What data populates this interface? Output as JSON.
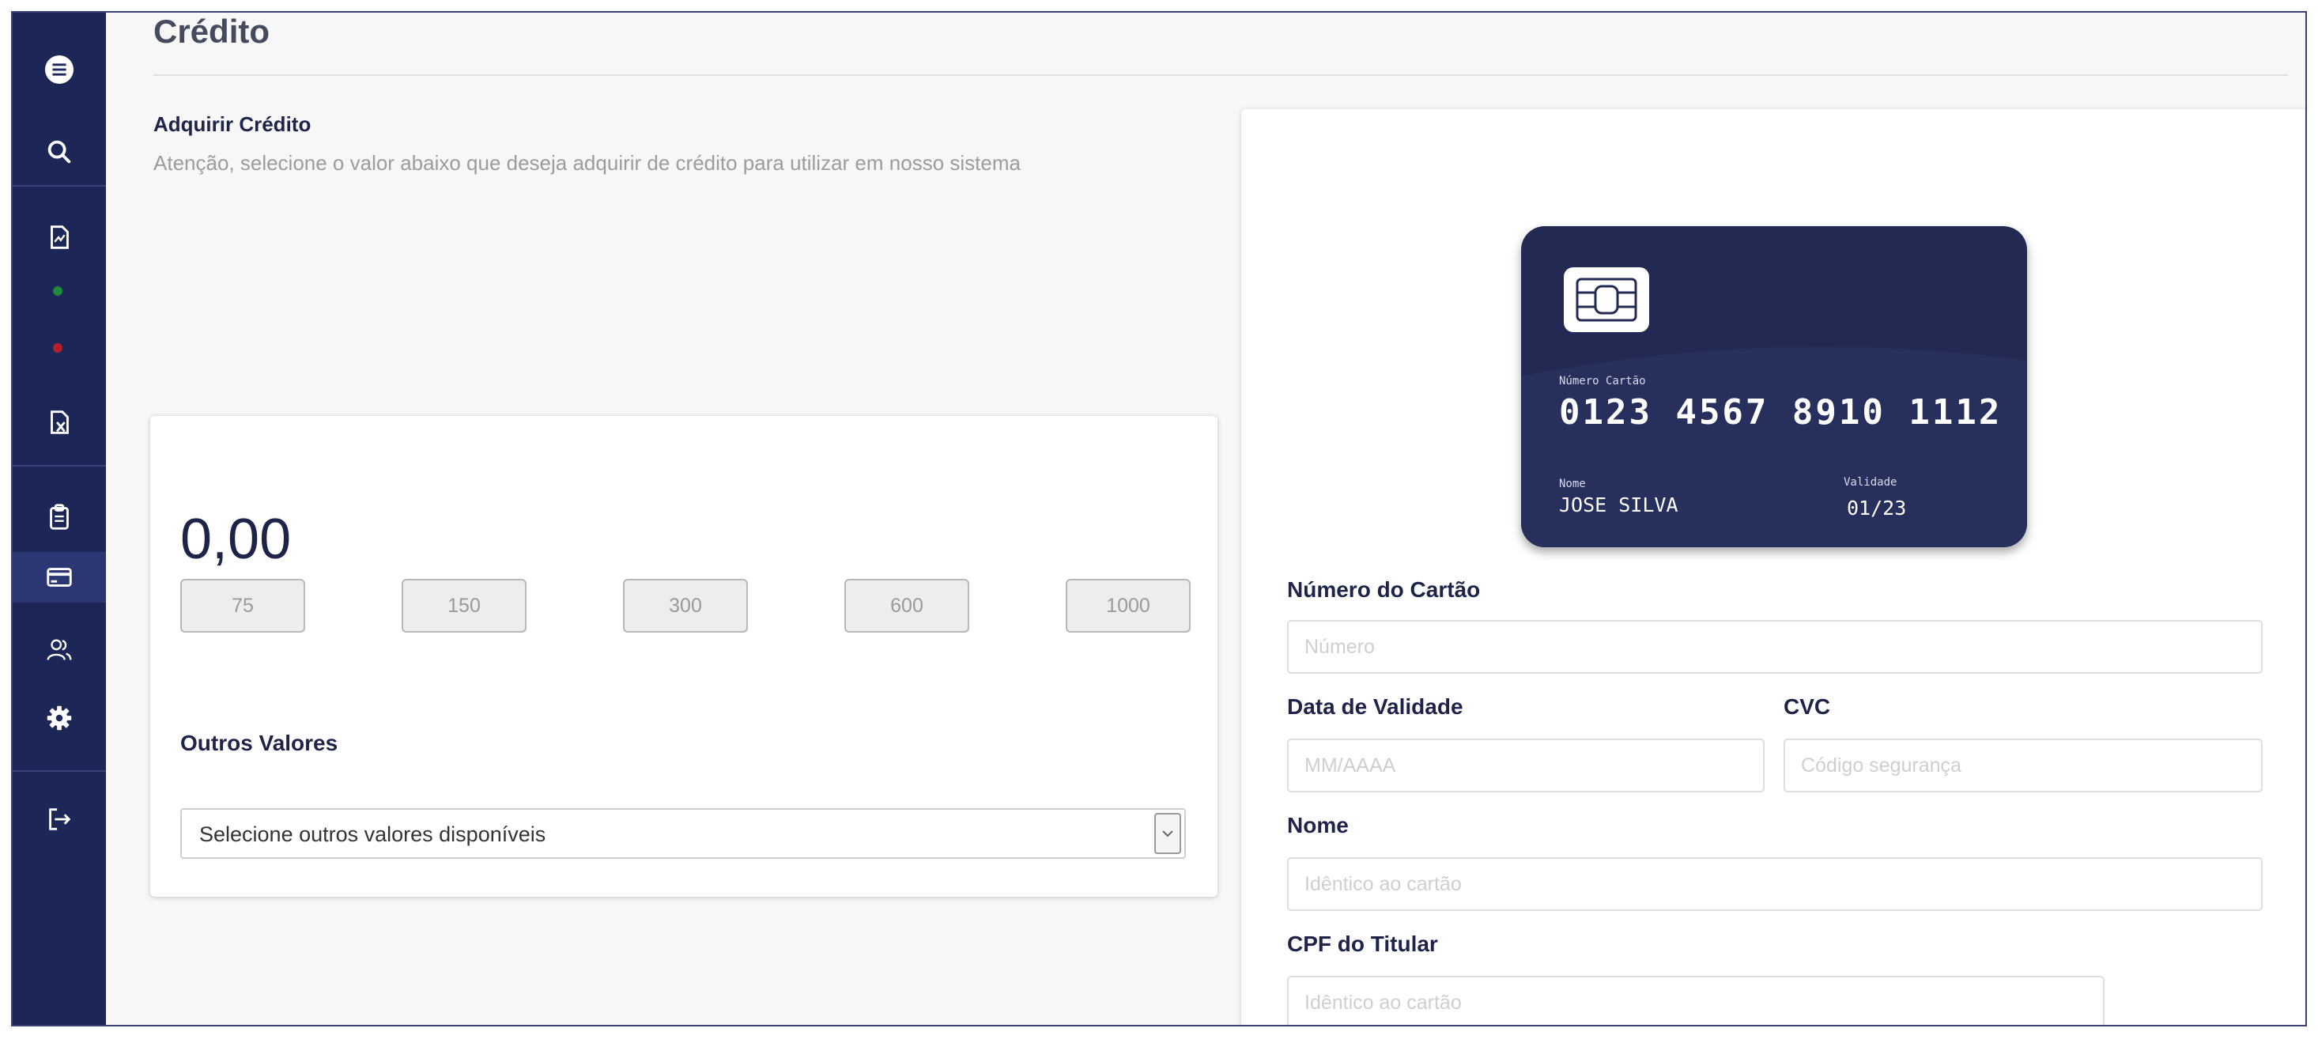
{
  "page": {
    "title": "Crédito"
  },
  "sidebar": {
    "items": [
      {
        "name": "menu",
        "icon": "menu-icon"
      },
      {
        "name": "search",
        "icon": "search-icon"
      },
      {
        "name": "document",
        "icon": "document-chart-icon"
      },
      {
        "name": "status-green",
        "icon": "green-dot",
        "color": "#1f8a3a"
      },
      {
        "name": "status-red",
        "icon": "red-dot",
        "color": "#b3202a"
      },
      {
        "name": "document-x",
        "icon": "document-x-icon"
      },
      {
        "name": "clipboard",
        "icon": "clipboard-icon"
      },
      {
        "name": "credit-card",
        "icon": "credit-card-icon",
        "active": true
      },
      {
        "name": "users",
        "icon": "users-icon"
      },
      {
        "name": "settings",
        "icon": "gear-icon"
      },
      {
        "name": "logout",
        "icon": "logout-icon"
      }
    ]
  },
  "acquire": {
    "heading": "Adquirir Crédito",
    "notice": "Atenção, selecione o valor abaixo que deseja adquirir de crédito para utilizar em nosso sistema"
  },
  "credit": {
    "amount": "0,00",
    "options": [
      "75",
      "150",
      "300",
      "600",
      "1000"
    ],
    "other_label": "Outros Valores",
    "other_select": "Selecione outros valores disponíveis"
  },
  "card_preview": {
    "number_label": "Número Cartão",
    "number": "0123 4567 8910 1112",
    "name_label": "Nome",
    "name": "JOSE SILVA",
    "expiry_label": "Validade",
    "expiry": "01/23",
    "color": "#222a53"
  },
  "form": {
    "number_label": "Número do Cartão",
    "number_placeholder": "Número",
    "expiry_label": "Data de Validade",
    "expiry_placeholder": "MM/AAAA",
    "cvc_label": "CVC",
    "cvc_placeholder": "Código segurança",
    "name_label": "Nome",
    "name_placeholder": "Idêntico ao cartão",
    "cpf_label": "CPF do Titular",
    "cpf_placeholder": "Idêntico ao cartão"
  },
  "colors": {
    "sidebar": "#1c2657",
    "accent": "#1e2449"
  }
}
